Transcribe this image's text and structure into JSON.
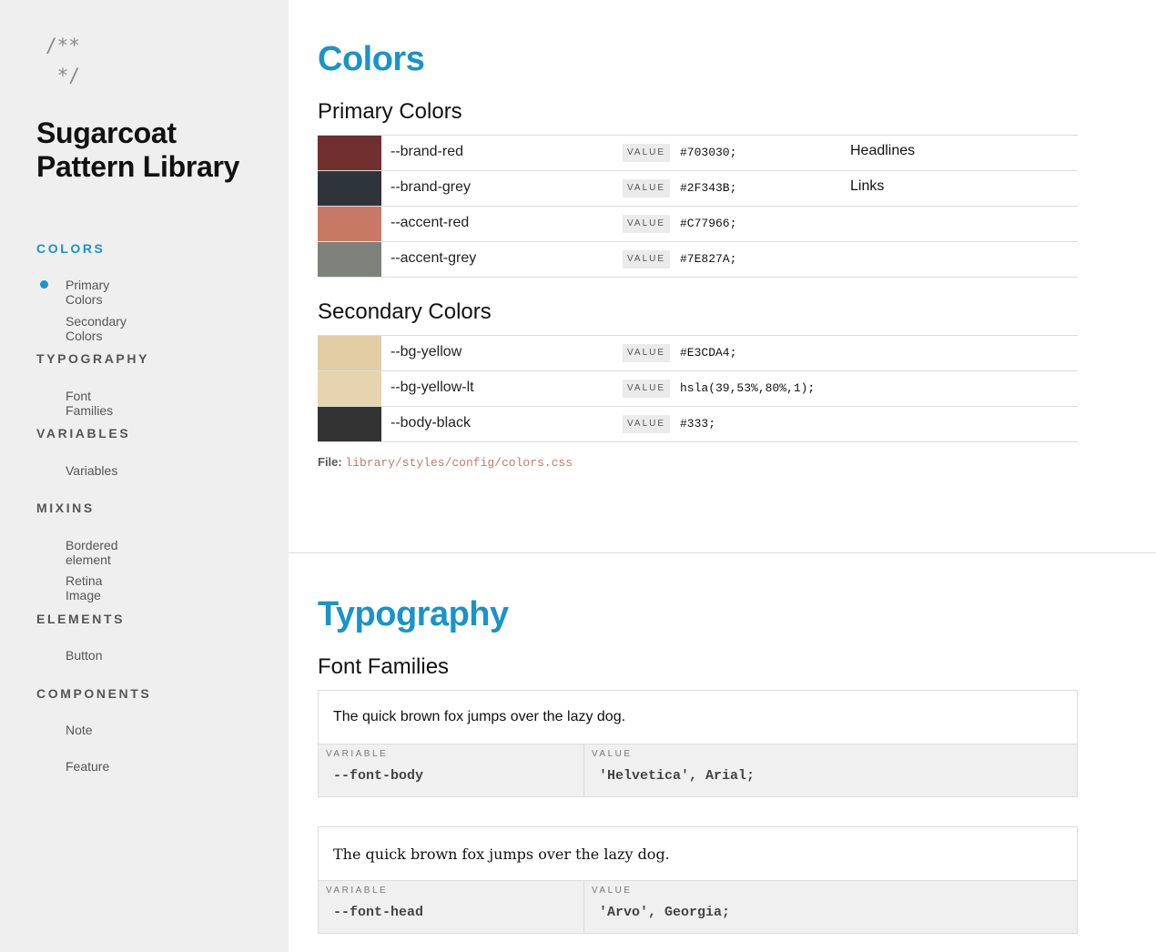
{
  "sidebar": {
    "logo_line1": "/**",
    "logo_line2": " */",
    "title": "Sugarcoat Pattern Library",
    "sections": [
      {
        "heading": "COLORS",
        "items": [
          "Primary Colors",
          "Secondary Colors"
        ]
      },
      {
        "heading": "TYPOGRAPHY",
        "items": [
          "Font Families"
        ]
      },
      {
        "heading": "VARIABLES",
        "items": [
          "Variables"
        ]
      },
      {
        "heading": "MIXINS",
        "items": [
          "Bordered element",
          "Retina Image"
        ]
      },
      {
        "heading": "ELEMENTS",
        "items": [
          "Button"
        ]
      },
      {
        "heading": "COMPONENTS",
        "items": [
          "Note",
          "Feature"
        ]
      }
    ],
    "active_color": "#1a93c9"
  },
  "colors": {
    "title": "Colors",
    "primary_title": "Primary Colors",
    "secondary_title": "Secondary Colors",
    "value_label": "VALUE",
    "primary": [
      {
        "name": "--brand-red",
        "value": "#703030;",
        "swatch": "#703030",
        "usage": "Headlines"
      },
      {
        "name": "--brand-grey",
        "value": "#2F343B;",
        "swatch": "#2F343B",
        "usage": "Links"
      },
      {
        "name": "--accent-red",
        "value": "#C77966;",
        "swatch": "#C77966",
        "usage": ""
      },
      {
        "name": "--accent-grey",
        "value": "#7E827A;",
        "swatch": "#7E827A",
        "usage": ""
      }
    ],
    "secondary": [
      {
        "name": "--bg-yellow",
        "value": "#E3CDA4;",
        "swatch": "#E3CDA4",
        "usage": ""
      },
      {
        "name": "--bg-yellow-lt",
        "value": "hsla(39,53%,80%,1);",
        "swatch": "#E6D4AE",
        "usage": ""
      },
      {
        "name": "--body-black",
        "value": "#333;",
        "swatch": "#333333",
        "usage": ""
      }
    ],
    "file_label": "File:",
    "file_path": "library/styles/config/colors.css"
  },
  "typography": {
    "title": "Typography",
    "families_title": "Font Families",
    "variable_label": "VARIABLE",
    "value_label": "VALUE",
    "cards": [
      {
        "sample": "The quick brown fox jumps over the lazy dog.",
        "variable": "--font-body",
        "value": "'Helvetica', Arial;"
      },
      {
        "sample": "The quick brown fox jumps over the lazy dog.",
        "variable": "--font-head",
        "value": "'Arvo', Georgia;"
      }
    ]
  }
}
